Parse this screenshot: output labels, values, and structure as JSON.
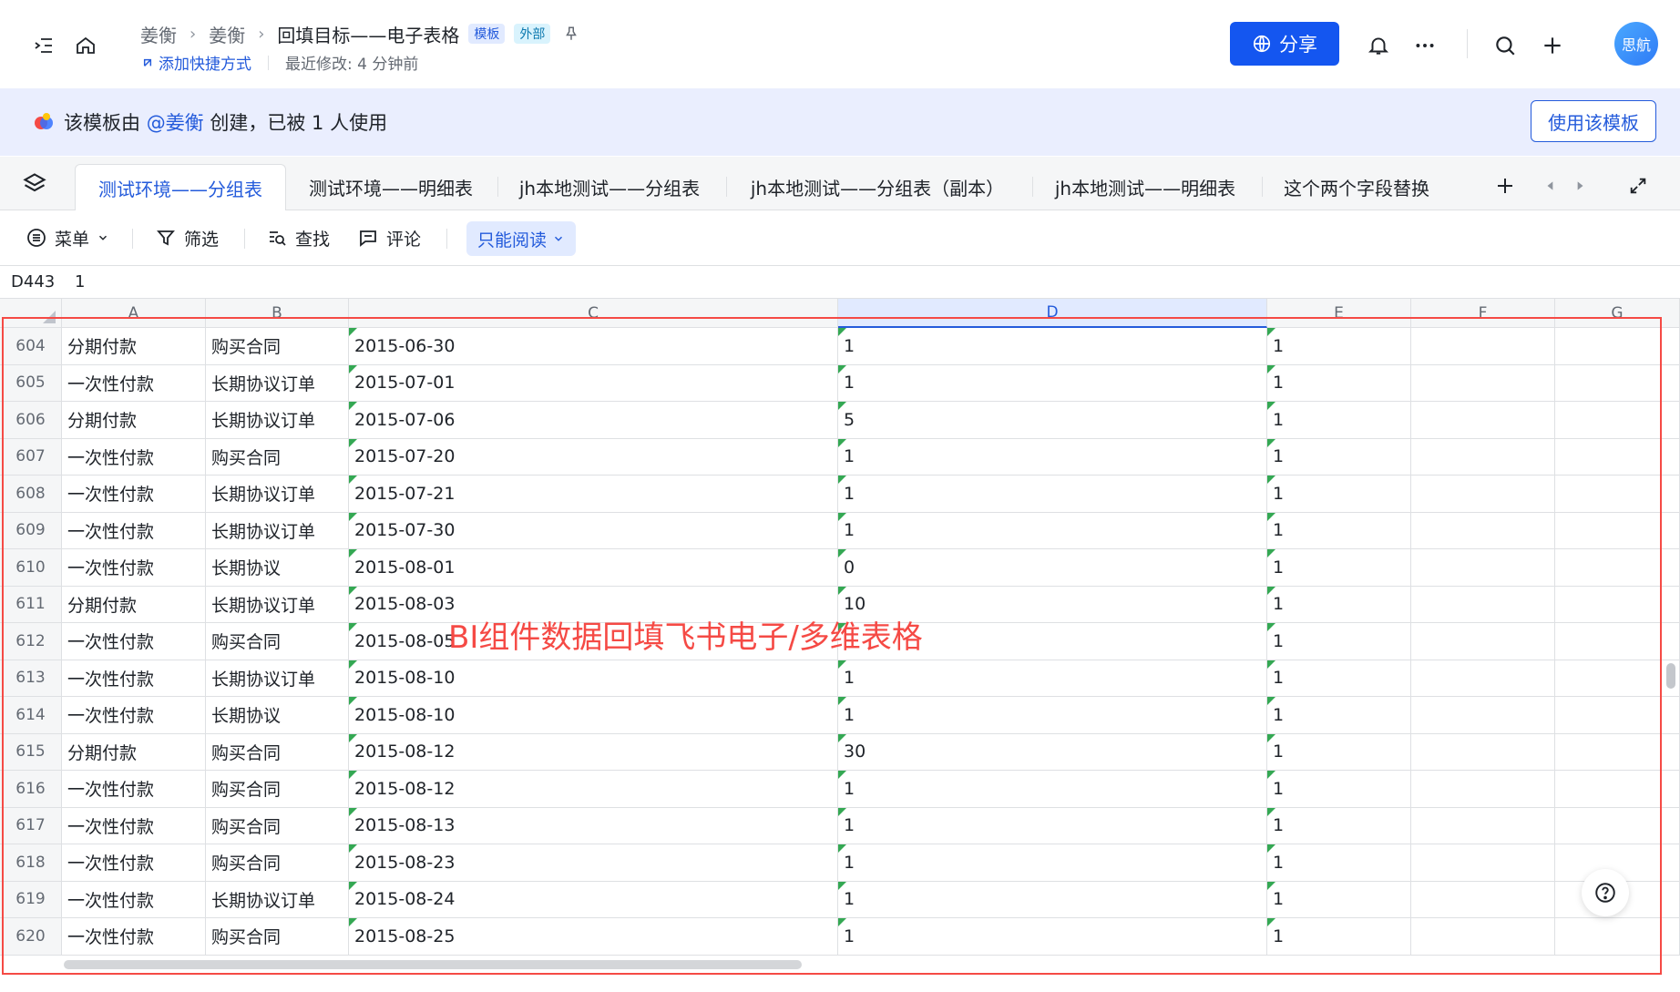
{
  "header": {
    "breadcrumb": [
      "姜衡",
      "姜衡"
    ],
    "doc_title": "回填目标——电子表格",
    "tag_template": "模板",
    "tag_external": "外部",
    "add_shortcut": "添加快捷方式",
    "last_modified": "最近修改: 4 分钟前",
    "share_label": "分享",
    "avatar_text": "思航"
  },
  "banner": {
    "prefix": "该模板由 ",
    "author": "@姜衡",
    "suffix": " 创建，已被 1 人使用",
    "use_template": "使用该模板"
  },
  "sheet_tabs": [
    "测试环境——分组表",
    "测试环境——明细表",
    "jh本地测试——分组表",
    "jh本地测试——分组表（副本）",
    "jh本地测试——明细表",
    "这个两个字段替换"
  ],
  "toolbar": {
    "menu": "菜单",
    "filter": "筛选",
    "find": "查找",
    "comment": "评论",
    "read_only": "只能阅读"
  },
  "formula_bar": {
    "cell_ref": "D443",
    "value": "1"
  },
  "columns": [
    "A",
    "B",
    "C",
    "D",
    "E",
    "F",
    "G"
  ],
  "rows": [
    {
      "num": "604",
      "a": "分期付款",
      "b": "购买合同",
      "c": "2015-06-30",
      "d": "1",
      "e": "1"
    },
    {
      "num": "605",
      "a": "一次性付款",
      "b": "长期协议订单",
      "c": "2015-07-01",
      "d": "1",
      "e": "1"
    },
    {
      "num": "606",
      "a": "分期付款",
      "b": "长期协议订单",
      "c": "2015-07-06",
      "d": "5",
      "e": "1"
    },
    {
      "num": "607",
      "a": "一次性付款",
      "b": "购买合同",
      "c": "2015-07-20",
      "d": "1",
      "e": "1"
    },
    {
      "num": "608",
      "a": "一次性付款",
      "b": "长期协议订单",
      "c": "2015-07-21",
      "d": "1",
      "e": "1"
    },
    {
      "num": "609",
      "a": "一次性付款",
      "b": "长期协议订单",
      "c": "2015-07-30",
      "d": "1",
      "e": "1"
    },
    {
      "num": "610",
      "a": "一次性付款",
      "b": "长期协议",
      "c": "2015-08-01",
      "d": "0",
      "e": "1"
    },
    {
      "num": "611",
      "a": "分期付款",
      "b": "长期协议订单",
      "c": "2015-08-03",
      "d": "10",
      "e": "1"
    },
    {
      "num": "612",
      "a": "一次性付款",
      "b": "购买合同",
      "c": "2015-08-05",
      "d": "",
      "e": "1"
    },
    {
      "num": "613",
      "a": "一次性付款",
      "b": "长期协议订单",
      "c": "2015-08-10",
      "d": "1",
      "e": "1"
    },
    {
      "num": "614",
      "a": "一次性付款",
      "b": "长期协议",
      "c": "2015-08-10",
      "d": "1",
      "e": "1"
    },
    {
      "num": "615",
      "a": "分期付款",
      "b": "购买合同",
      "c": "2015-08-12",
      "d": "30",
      "e": "1"
    },
    {
      "num": "616",
      "a": "一次性付款",
      "b": "购买合同",
      "c": "2015-08-12",
      "d": "1",
      "e": "1"
    },
    {
      "num": "617",
      "a": "一次性付款",
      "b": "购买合同",
      "c": "2015-08-13",
      "d": "1",
      "e": "1"
    },
    {
      "num": "618",
      "a": "一次性付款",
      "b": "购买合同",
      "c": "2015-08-23",
      "d": "1",
      "e": "1"
    },
    {
      "num": "619",
      "a": "一次性付款",
      "b": "长期协议订单",
      "c": "2015-08-24",
      "d": "1",
      "e": "1"
    },
    {
      "num": "620",
      "a": "一次性付款",
      "b": "购买合同",
      "c": "2015-08-25",
      "d": "1",
      "e": "1"
    }
  ],
  "annotation": "BI组件数据回填飞书电子/多维表格",
  "icons": {
    "sidebar_toggle": "sidebar-toggle-icon",
    "home": "home-icon",
    "bell": "bell-icon",
    "more": "more-icon",
    "search": "search-icon",
    "plus": "plus-icon",
    "globe": "globe-icon",
    "help": "help-icon"
  },
  "colors": {
    "accent": "#1456f0",
    "annotation_red": "#f54a45",
    "banner_bg": "#eaeefe"
  }
}
